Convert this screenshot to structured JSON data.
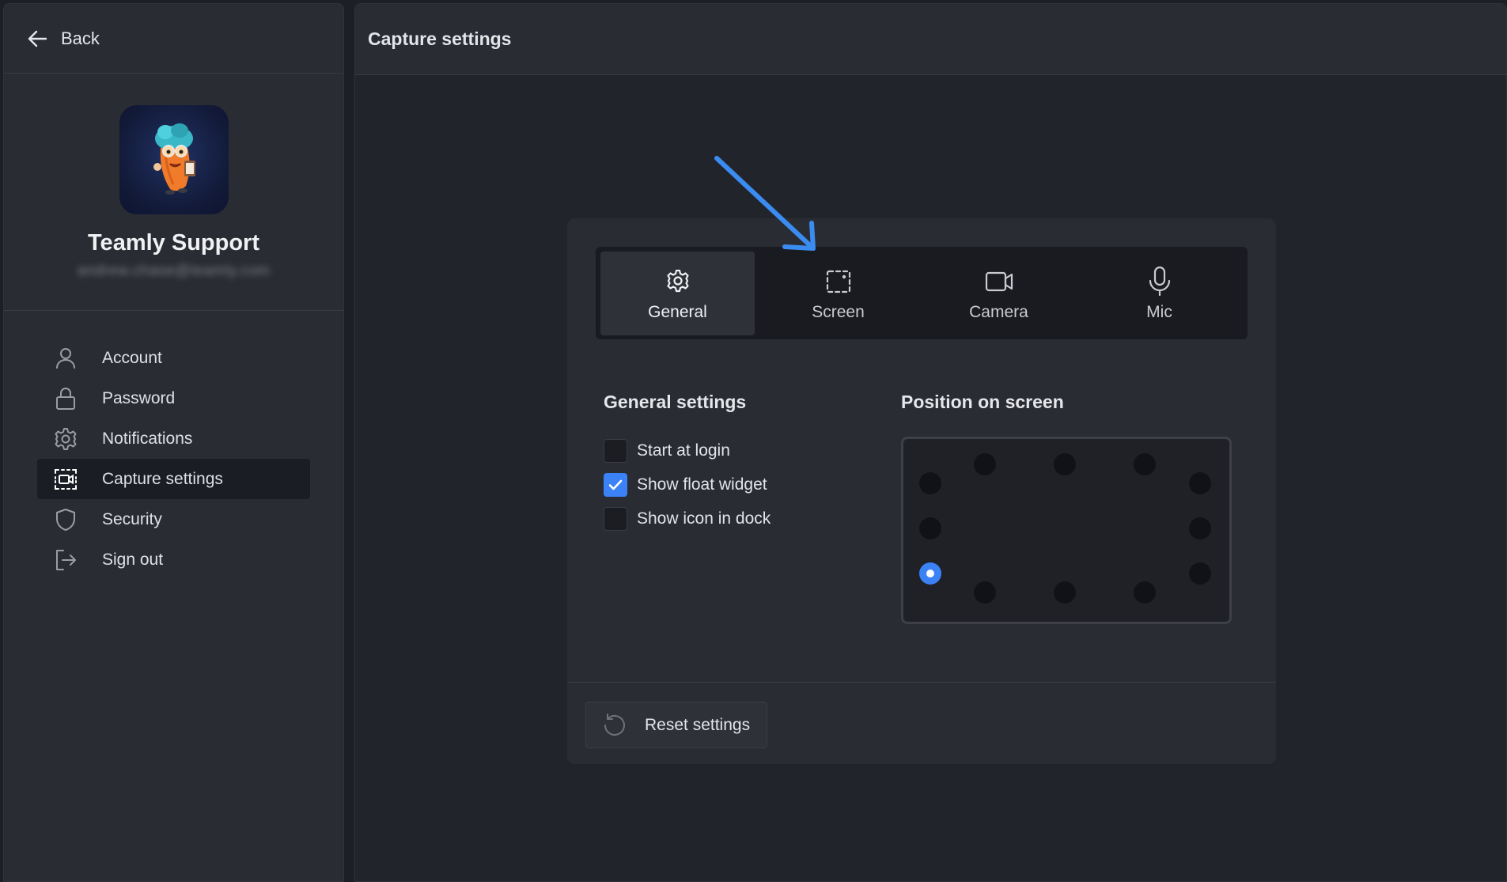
{
  "sidebar": {
    "back_label": "Back",
    "profile": {
      "name": "Teamly Support",
      "email": "andrew.chase@teamly.com"
    },
    "items": [
      {
        "label": "Account",
        "icon": "user-icon"
      },
      {
        "label": "Password",
        "icon": "lock-icon"
      },
      {
        "label": "Notifications",
        "icon": "gear-icon"
      },
      {
        "label": "Capture settings",
        "icon": "screen-capture-icon",
        "active": true
      },
      {
        "label": "Security",
        "icon": "shield-icon"
      },
      {
        "label": "Sign out",
        "icon": "sign-out-icon"
      }
    ]
  },
  "main": {
    "title": "Capture settings",
    "tabs": [
      {
        "label": "General",
        "icon": "gear-icon",
        "active": true
      },
      {
        "label": "Screen",
        "icon": "screen-select-icon"
      },
      {
        "label": "Camera",
        "icon": "camera-icon"
      },
      {
        "label": "Mic",
        "icon": "microphone-icon"
      }
    ],
    "general": {
      "title": "General settings",
      "options": [
        {
          "label": "Start at login",
          "checked": false
        },
        {
          "label": "Show float widget",
          "checked": true
        },
        {
          "label": "Show icon in dock",
          "checked": false
        }
      ]
    },
    "position": {
      "title": "Position on screen",
      "selected": "left-bottom"
    },
    "reset_label": "Reset settings"
  },
  "colors": {
    "accent": "#3b82f6",
    "background": "#1d1f26",
    "panel": "#2a2c34"
  }
}
